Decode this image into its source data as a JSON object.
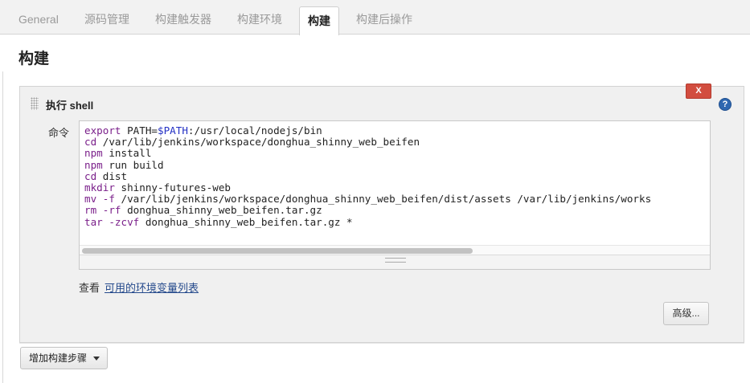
{
  "tabs": [
    {
      "label": "General"
    },
    {
      "label": "源码管理"
    },
    {
      "label": "构建触发器"
    },
    {
      "label": "构建环境"
    },
    {
      "label": "构建",
      "active": true
    },
    {
      "label": "构建后操作"
    }
  ],
  "section": {
    "title": "构建"
  },
  "step": {
    "title": "执行 shell",
    "delete_label": "X",
    "help_icon": "question-circle-icon",
    "command_label": "命令",
    "command_lines": [
      {
        "a": "export",
        "b": " PATH=",
        "c": "$PATH",
        "d": ":/usr/local/nodejs/bin"
      },
      {
        "a": "cd",
        "b": " /var/lib/jenkins/workspace/donghua_shinny_web_beifen"
      },
      {
        "a": "npm",
        "b": " install"
      },
      {
        "a": "npm",
        "b": " run build"
      },
      {
        "a": "cd",
        "b": " dist"
      },
      {
        "a": "mkdir",
        "b": " shinny-futures-web"
      },
      {
        "a": "mv",
        "b": " ",
        "c": "-f",
        "d": " /var/lib/jenkins/workspace/donghua_shinny_web_beifen/dist/assets /var/lib/jenkins/works"
      },
      {
        "a": "rm",
        "b": " ",
        "c": "-rf",
        "d": " donghua_shinny_web_beifen.tar.gz"
      },
      {
        "a": "tar",
        "b": " ",
        "c": "-zcvf",
        "d": " donghua_shinny_web_beifen.tar.gz *"
      }
    ],
    "env_prefix": "查看",
    "env_link": "可用的环境变量列表",
    "advanced_label": "高级..."
  },
  "add_step_label": "增加构建步骤",
  "colors": {
    "delete": "#d24d3f",
    "help": "#2f67b0",
    "link": "#254a8c",
    "keyword": "#7a1f8a",
    "variable": "#2330c4"
  }
}
